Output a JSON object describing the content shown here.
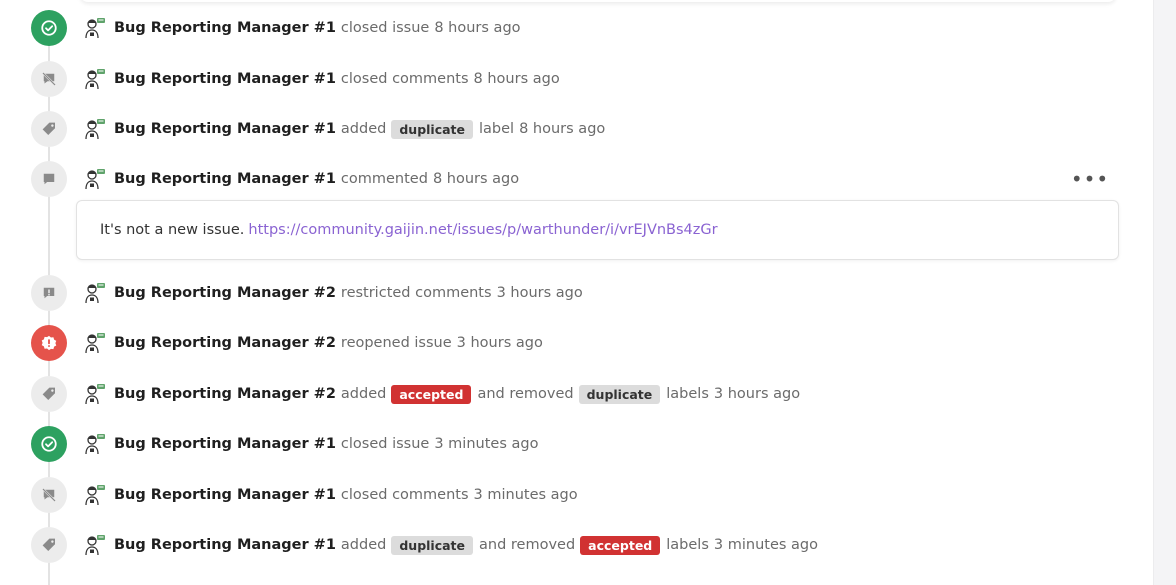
{
  "events": [
    {
      "author": "Bug Reporting Manager #1",
      "action": "closed issue",
      "time": "8 hours ago",
      "icon": "check-circle-icon",
      "tone": "closed"
    },
    {
      "author": "Bug Reporting Manager #1",
      "action": "closed comments",
      "time": "8 hours ago",
      "icon": "comment-off-icon",
      "tone": "neutral"
    },
    {
      "author": "Bug Reporting Manager #1",
      "action": "added",
      "label": "duplicate",
      "suffix": "label",
      "time": "8 hours ago",
      "icon": "tag-icon",
      "tone": "neutral"
    },
    {
      "author": "Bug Reporting Manager #1",
      "action": "commented",
      "time": "8 hours ago",
      "icon": "comment-icon",
      "tone": "neutral",
      "more_label": "•••"
    },
    {
      "author": "Bug Reporting Manager #2",
      "action": "restricted comments",
      "time": "3 hours ago",
      "icon": "comment-alert-icon",
      "tone": "neutral"
    },
    {
      "author": "Bug Reporting Manager #2",
      "action": "reopened issue",
      "time": "3 hours ago",
      "icon": "alert-circle-icon",
      "tone": "reopened"
    },
    {
      "author": "Bug Reporting Manager #2",
      "action": "added",
      "label_added": "accepted",
      "conj": "and removed",
      "label_removed": "duplicate",
      "suffix": "labels",
      "time": "3 hours ago",
      "icon": "tag-icon",
      "tone": "neutral"
    },
    {
      "author": "Bug Reporting Manager #1",
      "action": "closed issue",
      "time": "3 minutes ago",
      "icon": "check-circle-icon",
      "tone": "closed"
    },
    {
      "author": "Bug Reporting Manager #1",
      "action": "closed comments",
      "time": "3 minutes ago",
      "icon": "comment-off-icon",
      "tone": "neutral"
    },
    {
      "author": "Bug Reporting Manager #1",
      "action": "added",
      "label_added": "duplicate",
      "conj": "and removed",
      "label_removed": "accepted",
      "suffix": "labels",
      "time": "3 minutes ago",
      "icon": "tag-icon",
      "tone": "neutral"
    }
  ],
  "comment": {
    "text": "It's not a new issue.",
    "link": "https://community.gaijin.net/issues/p/warthunder/i/vrEJVnBs4zGr"
  },
  "colors": {
    "closed": "#2da160",
    "reopened": "#e5534b",
    "neutral_badge": "#ececec",
    "label_duplicate": "#dcdcdc",
    "label_accepted": "#d13232",
    "link": "#8a63d2"
  }
}
